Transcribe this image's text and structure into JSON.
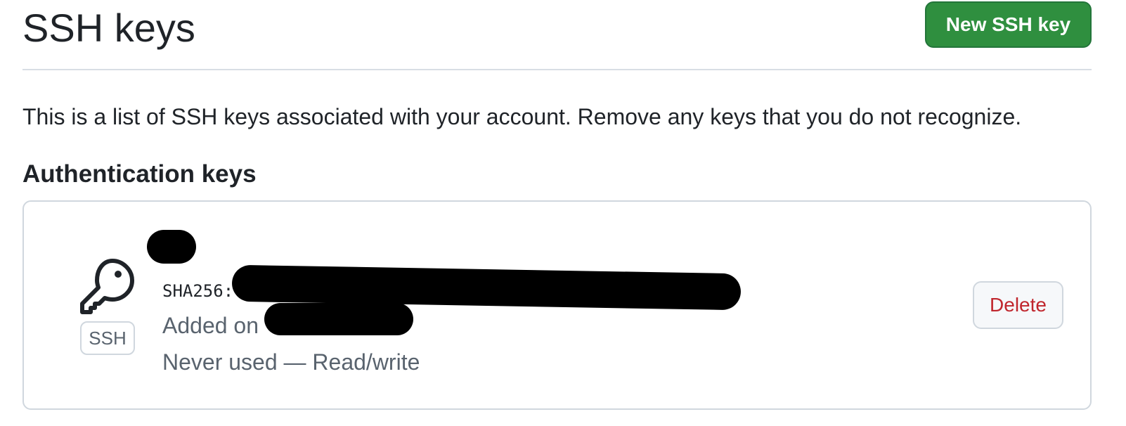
{
  "header": {
    "title": "SSH keys",
    "new_key_label": "New SSH key"
  },
  "description": "This is a list of SSH keys associated with your account. Remove any keys that you do not recognize.",
  "section": {
    "heading": "Authentication keys"
  },
  "key": {
    "icon": "key-icon",
    "badge": "SSH",
    "fingerprint_prefix": "SHA256:",
    "added_prefix": "Added on",
    "usage": "Never used — Read/write",
    "delete_label": "Delete"
  },
  "colors": {
    "primary_button": "#2f8f3f",
    "danger_text": "#c0262d",
    "muted_text": "#59636e",
    "border": "#d0d7de"
  }
}
